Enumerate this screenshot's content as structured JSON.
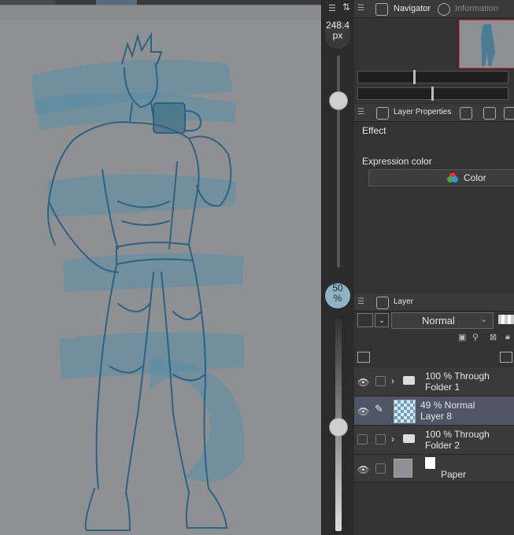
{
  "brush_size": {
    "value": "248.4",
    "unit": "px"
  },
  "opacity": {
    "value": "50",
    "unit": "%"
  },
  "navigator": {
    "tab_navigator": "Navigator",
    "tab_information": "Information"
  },
  "layer_properties": {
    "title": "Layer Properties",
    "effect_label": "Effect",
    "expression_color_label": "Expression color",
    "color_button": "Color"
  },
  "layer_panel": {
    "title": "Layer",
    "blend_mode": "Normal",
    "layers": [
      {
        "line1": "100 % Through",
        "line2": "Folder 1",
        "type": "folder",
        "visible": true,
        "selected": false
      },
      {
        "line1": "49 % Normal",
        "line2": "Layer 8",
        "type": "raster",
        "visible": true,
        "selected": true
      },
      {
        "line1": "100 % Through",
        "line2": "Folder 2",
        "type": "folder",
        "visible": false,
        "selected": false
      },
      {
        "line1": "",
        "line2": "Paper",
        "type": "paper",
        "visible": true,
        "selected": false
      }
    ]
  },
  "colors": {
    "sketch_blue": "#3d6f86",
    "selected_row": "#4e5666",
    "canvas_gray": "#8e9094"
  }
}
